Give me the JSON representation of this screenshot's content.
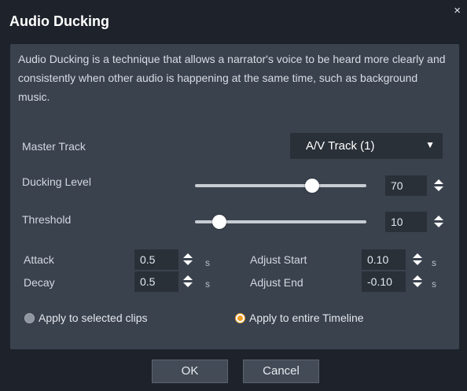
{
  "dialog": {
    "title": "Audio Ducking",
    "close_glyph": "×",
    "description": "Audio Ducking is a technique that allows a narrator's voice to be heard more clearly and consistently when other audio is happening at the same time, such as background music."
  },
  "master_track": {
    "label": "Master Track",
    "selected": "A/V Track (1)"
  },
  "ducking_level": {
    "label": "Ducking Level",
    "value": "70",
    "slider_fraction": 0.7
  },
  "threshold": {
    "label": "Threshold",
    "value": "10",
    "slider_fraction": 0.11
  },
  "attack": {
    "label": "Attack",
    "value": "0.5",
    "unit": "s"
  },
  "decay": {
    "label": "Decay",
    "value": "0.5",
    "unit": "s"
  },
  "adjust_start": {
    "label": "Adjust Start",
    "value": "0.10",
    "unit": "s"
  },
  "adjust_end": {
    "label": "Adjust End",
    "value": "-0.10",
    "unit": "s"
  },
  "apply_options": [
    {
      "label": "Apply to selected clips",
      "selected": false
    },
    {
      "label": "Apply to entire Timeline",
      "selected": true
    }
  ],
  "buttons": {
    "ok": "OK",
    "cancel": "Cancel"
  },
  "colors": {
    "background": "#1e232b",
    "panel": "#3a424e",
    "field": "#2a3038",
    "accent_radio": "#f29a1e"
  }
}
